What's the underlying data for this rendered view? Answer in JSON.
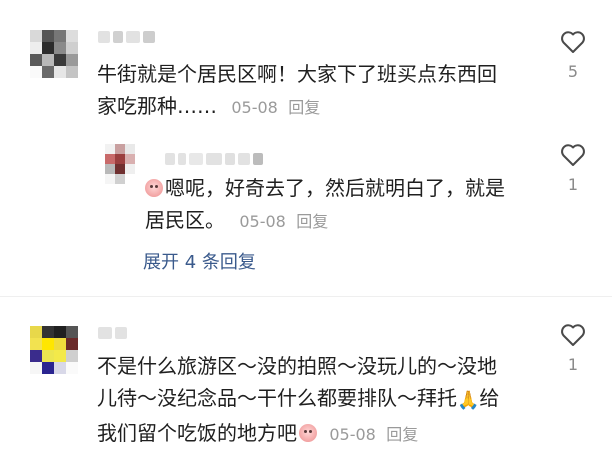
{
  "comments": [
    {
      "text_line1": "牛街就是个居民区啊！大家下了班买点东西回",
      "text_line2": "家吃那种……",
      "date": "05-08",
      "reply_label": "回复",
      "likes": "5",
      "like_icon": "heart-outline-icon"
    },
    {
      "emoji": "crying-face-emoji",
      "text_line1": "嗯呢，好奇去了，然后就明白了，就是",
      "text_line2": "居民区。",
      "date": "05-08",
      "reply_label": "回复",
      "likes": "1",
      "like_icon": "heart-outline-icon"
    },
    {
      "text_line1": "不是什么旅游区～没的拍照～没玩儿的～没地",
      "text_line2a": "儿待～没纪念品～干什么都要排队～拜托",
      "pray_emoji": "🙏",
      "text_line2b": "给",
      "text_line3": "我们留个吃饭的地方吧",
      "emoji": "crying-face-emoji",
      "date": "05-08",
      "reply_label": "回复",
      "likes": "1",
      "like_icon": "heart-outline-icon"
    }
  ],
  "expand_replies": "展开 4 条回复",
  "colors": {
    "text": "#1f1f1f",
    "meta": "#9a9a9a",
    "link": "#3a5a8c",
    "background": "#ffffff"
  }
}
